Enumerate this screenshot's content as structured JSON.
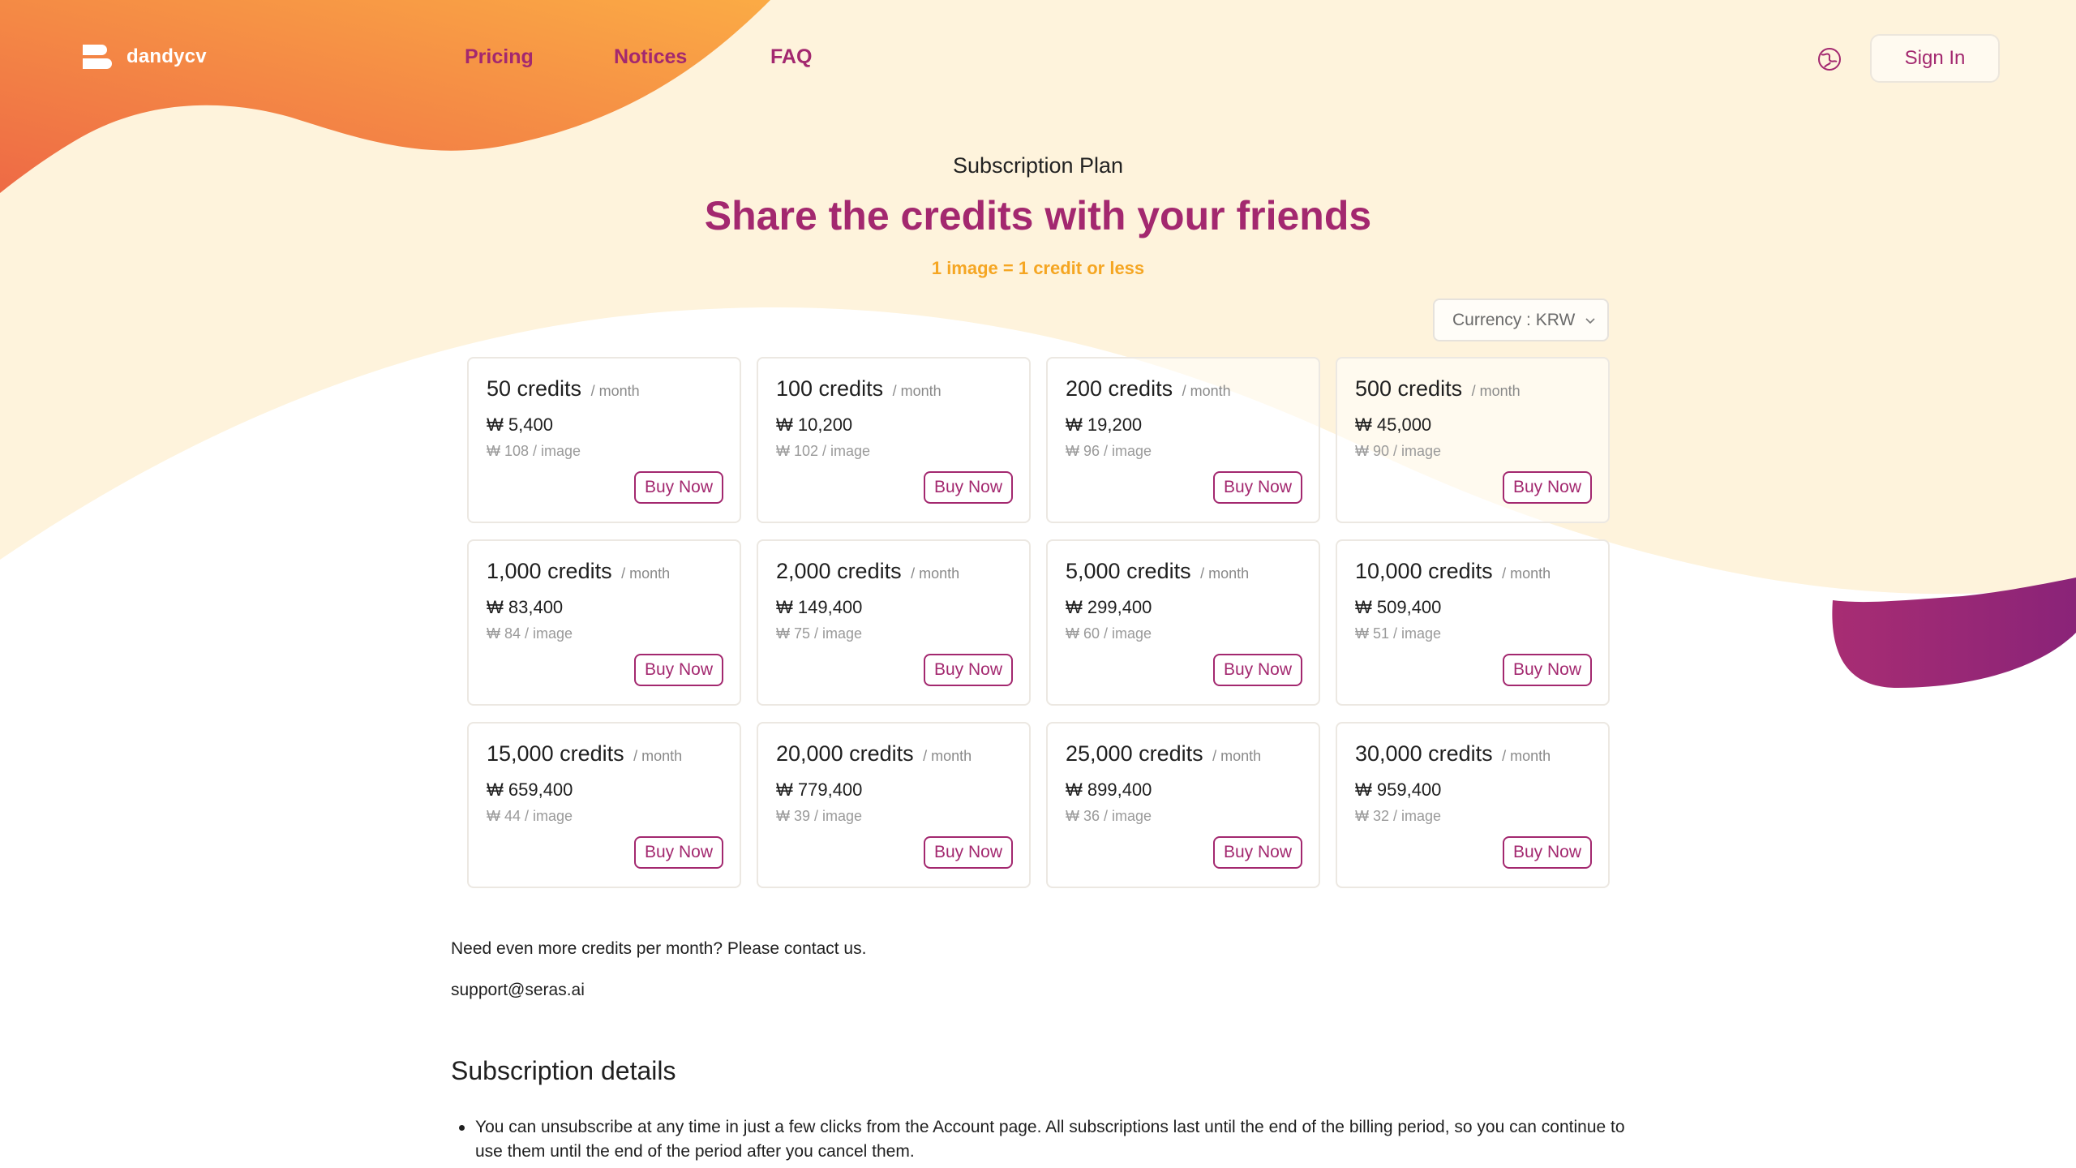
{
  "brand": {
    "name": "dandycv"
  },
  "nav": {
    "pricing": "Pricing",
    "notices": "Notices",
    "faq": "FAQ"
  },
  "header": {
    "signin_label": "Sign In",
    "language_icon": "globe-icon"
  },
  "hero": {
    "subtitle": "Subscription Plan",
    "title": "Share the credits with your friends",
    "tagline": "1 image = 1 credit or less"
  },
  "currency": {
    "label": "Currency : KRW",
    "options_selected": "KRW"
  },
  "plans": [
    {
      "credits": "50 credits",
      "period": "/ month",
      "price": "₩ 5,400",
      "per_image": "₩ 108 / image",
      "buy": "Buy Now"
    },
    {
      "credits": "100 credits",
      "period": "/ month",
      "price": "₩ 10,200",
      "per_image": "₩ 102 / image",
      "buy": "Buy Now"
    },
    {
      "credits": "200 credits",
      "period": "/ month",
      "price": "₩ 19,200",
      "per_image": "₩ 96 / image",
      "buy": "Buy Now"
    },
    {
      "credits": "500 credits",
      "period": "/ month",
      "price": "₩ 45,000",
      "per_image": "₩ 90 / image",
      "buy": "Buy Now"
    },
    {
      "credits": "1,000 credits",
      "period": "/ month",
      "price": "₩ 83,400",
      "per_image": "₩ 84 / image",
      "buy": "Buy Now"
    },
    {
      "credits": "2,000 credits",
      "period": "/ month",
      "price": "₩ 149,400",
      "per_image": "₩ 75 / image",
      "buy": "Buy Now"
    },
    {
      "credits": "5,000 credits",
      "period": "/ month",
      "price": "₩ 299,400",
      "per_image": "₩ 60 / image",
      "buy": "Buy Now"
    },
    {
      "credits": "10,000 credits",
      "period": "/ month",
      "price": "₩ 509,400",
      "per_image": "₩ 51 / image",
      "buy": "Buy Now"
    },
    {
      "credits": "15,000 credits",
      "period": "/ month",
      "price": "₩ 659,400",
      "per_image": "₩ 44 / image",
      "buy": "Buy Now"
    },
    {
      "credits": "20,000 credits",
      "period": "/ month",
      "price": "₩ 779,400",
      "per_image": "₩ 39 / image",
      "buy": "Buy Now"
    },
    {
      "credits": "25,000 credits",
      "period": "/ month",
      "price": "₩ 899,400",
      "per_image": "₩ 36 / image",
      "buy": "Buy Now"
    },
    {
      "credits": "30,000 credits",
      "period": "/ month",
      "price": "₩ 959,400",
      "per_image": "₩ 32 / image",
      "buy": "Buy Now"
    }
  ],
  "contact": {
    "text": "Need even more credits per month? Please contact us.",
    "email": "support@seras.ai"
  },
  "details": {
    "title": "Subscription details",
    "items": [
      "You can unsubscribe at any time in just a few clicks from the Account page. All subscriptions last until the end of the billing period, so you can continue to use them until the end of the period after you cancel them."
    ]
  },
  "colors": {
    "accent": "#a3286f",
    "tagline": "#f5a623",
    "cream": "#fef3dc",
    "orange": "#f08a43"
  }
}
